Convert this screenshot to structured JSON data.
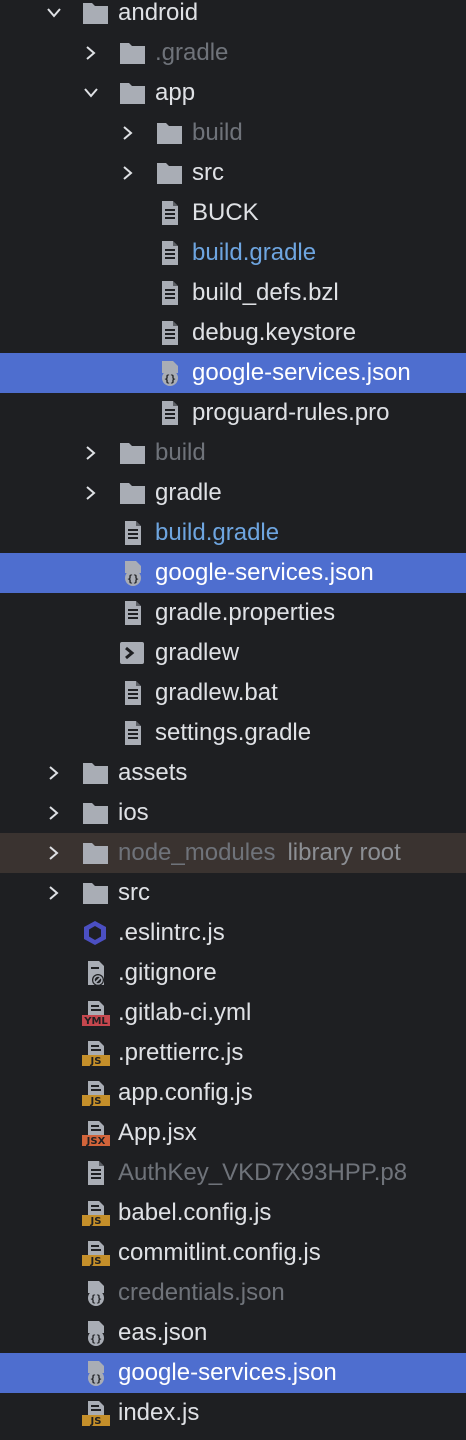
{
  "colors": {
    "background": "#1e1f22",
    "selection": "#4e6ecf",
    "library_row": "#3a3330",
    "text": "#dfe1e5",
    "text_dim": "#6f737a",
    "text_modified": "#6ea5e0",
    "folder": "#a9adb5",
    "js_badge": "#c58f2a",
    "jsx_badge": "#d2643a",
    "yml_badge": "#c5474e",
    "eslint_hex": "#4b4fc2"
  },
  "tree": {
    "rows": [
      {
        "label": "android",
        "depth": 0,
        "icon": "folder-icon",
        "chevron": "expanded",
        "state": "normal"
      },
      {
        "label": ".gradle",
        "depth": 1,
        "icon": "folder-icon",
        "chevron": "collapsed",
        "state": "dim"
      },
      {
        "label": "app",
        "depth": 1,
        "icon": "folder-icon",
        "chevron": "expanded",
        "state": "normal"
      },
      {
        "label": "build",
        "depth": 2,
        "icon": "folder-icon",
        "chevron": "collapsed",
        "state": "dim"
      },
      {
        "label": "src",
        "depth": 2,
        "icon": "folder-icon",
        "chevron": "collapsed",
        "state": "normal"
      },
      {
        "label": "BUCK",
        "depth": 2,
        "icon": "text-file-icon",
        "chevron": "none",
        "state": "normal"
      },
      {
        "label": "build.gradle",
        "depth": 2,
        "icon": "text-file-icon",
        "chevron": "none",
        "state": "modified"
      },
      {
        "label": "build_defs.bzl",
        "depth": 2,
        "icon": "text-file-icon",
        "chevron": "none",
        "state": "normal"
      },
      {
        "label": "debug.keystore",
        "depth": 2,
        "icon": "text-file-icon",
        "chevron": "none",
        "state": "normal"
      },
      {
        "label": "google-services.json",
        "depth": 2,
        "icon": "json-file-icon",
        "chevron": "none",
        "state": "selected"
      },
      {
        "label": "proguard-rules.pro",
        "depth": 2,
        "icon": "text-file-icon",
        "chevron": "none",
        "state": "normal"
      },
      {
        "label": "build",
        "depth": 1,
        "icon": "folder-icon",
        "chevron": "collapsed",
        "state": "dim"
      },
      {
        "label": "gradle",
        "depth": 1,
        "icon": "folder-icon",
        "chevron": "collapsed",
        "state": "normal"
      },
      {
        "label": "build.gradle",
        "depth": 1,
        "icon": "text-file-icon",
        "chevron": "none",
        "state": "modified"
      },
      {
        "label": "google-services.json",
        "depth": 1,
        "icon": "json-file-icon",
        "chevron": "none",
        "state": "selected"
      },
      {
        "label": "gradle.properties",
        "depth": 1,
        "icon": "text-file-icon",
        "chevron": "none",
        "state": "normal"
      },
      {
        "label": "gradlew",
        "depth": 1,
        "icon": "terminal-file-icon",
        "chevron": "none",
        "state": "normal"
      },
      {
        "label": "gradlew.bat",
        "depth": 1,
        "icon": "text-file-icon",
        "chevron": "none",
        "state": "normal"
      },
      {
        "label": "settings.gradle",
        "depth": 1,
        "icon": "text-file-icon",
        "chevron": "none",
        "state": "normal"
      },
      {
        "label": "assets",
        "depth": 0,
        "icon": "folder-icon",
        "chevron": "collapsed",
        "state": "normal"
      },
      {
        "label": "ios",
        "depth": 0,
        "icon": "folder-icon",
        "chevron": "collapsed",
        "state": "normal"
      },
      {
        "label": "node_modules",
        "suffix": "library root",
        "depth": 0,
        "icon": "folder-icon",
        "chevron": "collapsed",
        "state": "library"
      },
      {
        "label": "src",
        "depth": 0,
        "icon": "folder-icon",
        "chevron": "collapsed",
        "state": "normal"
      },
      {
        "label": ".eslintrc.js",
        "depth": 0,
        "icon": "eslint-icon",
        "chevron": "none",
        "state": "normal"
      },
      {
        "label": ".gitignore",
        "depth": 0,
        "icon": "ignore-file-icon",
        "chevron": "none",
        "state": "normal"
      },
      {
        "label": ".gitlab-ci.yml",
        "depth": 0,
        "icon": "yml-file-icon",
        "chevron": "none",
        "state": "normal"
      },
      {
        "label": ".prettierrc.js",
        "depth": 0,
        "icon": "js-file-icon",
        "chevron": "none",
        "state": "normal"
      },
      {
        "label": "app.config.js",
        "depth": 0,
        "icon": "js-file-icon",
        "chevron": "none",
        "state": "normal"
      },
      {
        "label": "App.jsx",
        "depth": 0,
        "icon": "jsx-file-icon",
        "chevron": "none",
        "state": "normal"
      },
      {
        "label": "AuthKey_VKD7X93HPP.p8",
        "depth": 0,
        "icon": "text-file-icon",
        "chevron": "none",
        "state": "dim"
      },
      {
        "label": "babel.config.js",
        "depth": 0,
        "icon": "js-file-icon",
        "chevron": "none",
        "state": "normal"
      },
      {
        "label": "commitlint.config.js",
        "depth": 0,
        "icon": "js-file-icon",
        "chevron": "none",
        "state": "normal"
      },
      {
        "label": "credentials.json",
        "depth": 0,
        "icon": "json-file-icon",
        "chevron": "none",
        "state": "dim"
      },
      {
        "label": "eas.json",
        "depth": 0,
        "icon": "json-file-icon",
        "chevron": "none",
        "state": "normal"
      },
      {
        "label": "google-services.json",
        "depth": 0,
        "icon": "json-file-icon",
        "chevron": "none",
        "state": "selected"
      },
      {
        "label": "index.js",
        "depth": 0,
        "icon": "js-file-icon",
        "chevron": "none",
        "state": "normal"
      }
    ]
  }
}
